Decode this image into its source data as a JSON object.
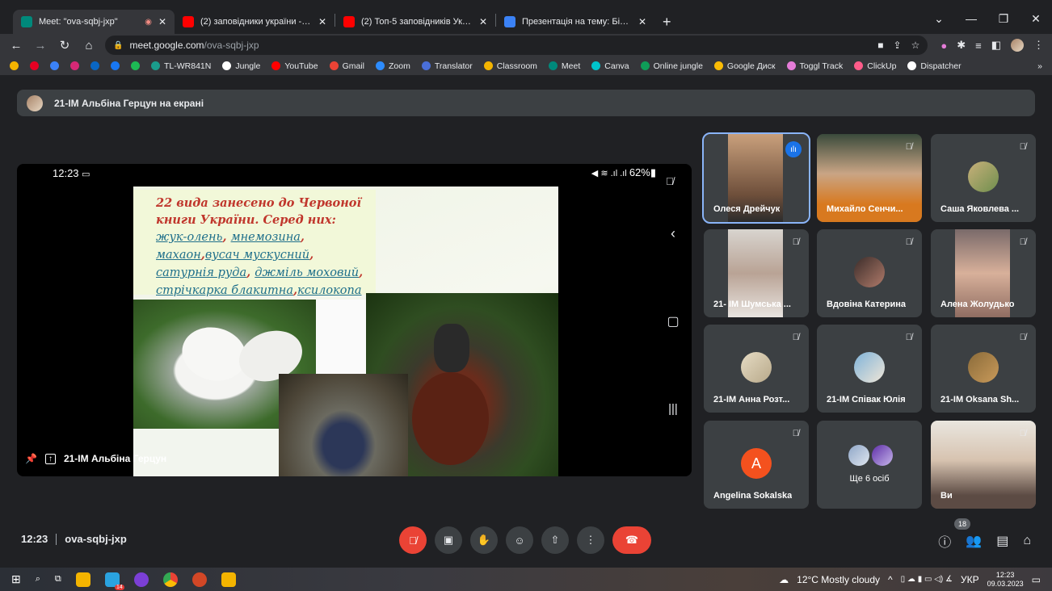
{
  "browser": {
    "tabs": [
      {
        "title": "Meet: \"ova-sqbj-jxp\"",
        "color": "#00897b"
      },
      {
        "title": "(2) заповідники україни - YouTube",
        "color": "#ff0000"
      },
      {
        "title": "(2) Топ-5 заповідників України",
        "color": "#ff0000"
      },
      {
        "title": "Презентація на тему: Біосферні",
        "color": "#3b82f6"
      }
    ],
    "url_host": "meet.google.com",
    "url_path": "/ova-sqbj-jxp"
  },
  "bookmarks": [
    {
      "label": "TL-WR841N",
      "color": "#1a9c8c"
    },
    {
      "label": "Jungle",
      "color": "#ffffff"
    },
    {
      "label": "YouTube",
      "color": "#ff0000"
    },
    {
      "label": "Gmail",
      "color": "#ea4335"
    },
    {
      "label": "Zoom",
      "color": "#2d8cff"
    },
    {
      "label": "Translator",
      "color": "#4a6fd8"
    },
    {
      "label": "Classroom",
      "color": "#f4b400"
    },
    {
      "label": "Meet",
      "color": "#00897b"
    },
    {
      "label": "Canva",
      "color": "#00c4cc"
    },
    {
      "label": "Online jungle",
      "color": "#0f9d58"
    },
    {
      "label": "Google Диск",
      "color": "#fbbc05"
    },
    {
      "label": "Toggl Track",
      "color": "#e57cd8"
    },
    {
      "label": "ClickUp",
      "color": "#ff5c8a"
    },
    {
      "label": "Dispatcher",
      "color": "#ffffff"
    }
  ],
  "meet": {
    "presenting_banner": "21-ІМ Альбіна Герцун на екрані",
    "phone_time": "12:23",
    "phone_battery": "62%",
    "slide_text_plain": "22 вида занесено до Червоної книги України. Серед них:",
    "slide_species": [
      "жук-олень",
      "мнемозина",
      "махаон",
      "вусач мускусний",
      "сатурнія руда",
      "джміль моховий",
      "стрічкарка блакитна",
      "ксилокопа звичайна"
    ],
    "presenter_label": "21-ІМ Альбіна Герцун",
    "meeting_time": "12:23",
    "meeting_code": "ova-sqbj-jxp",
    "participant_count": "18",
    "participants": [
      {
        "name": "Олеся Дрейчук",
        "speaking": true
      },
      {
        "name": "Михайло Сенчи...",
        "speaking": false
      },
      {
        "name": "Саша Яковлева ...",
        "speaking": false
      },
      {
        "name": "21- ІМ Шумська ...",
        "speaking": false
      },
      {
        "name": "Вдовіна Катерина",
        "speaking": false
      },
      {
        "name": "Алена Жолудько",
        "speaking": false
      },
      {
        "name": "21-ІМ Анна Розт...",
        "speaking": false
      },
      {
        "name": "21-ІМ Співак Юлія",
        "speaking": false
      },
      {
        "name": "21-ІМ Oksana Sh...",
        "speaking": false
      },
      {
        "name": "Angelina Sokalska",
        "speaking": false,
        "initial": "A"
      },
      {
        "name": "Ще 6 осіб",
        "speaking": false
      },
      {
        "name": "Ви",
        "speaking": false
      }
    ]
  },
  "taskbar": {
    "weather": "12°C  Mostly cloudy",
    "lang": "УКР",
    "time": "12:23",
    "date": "09.03.2023",
    "telegram_badge": "14"
  }
}
